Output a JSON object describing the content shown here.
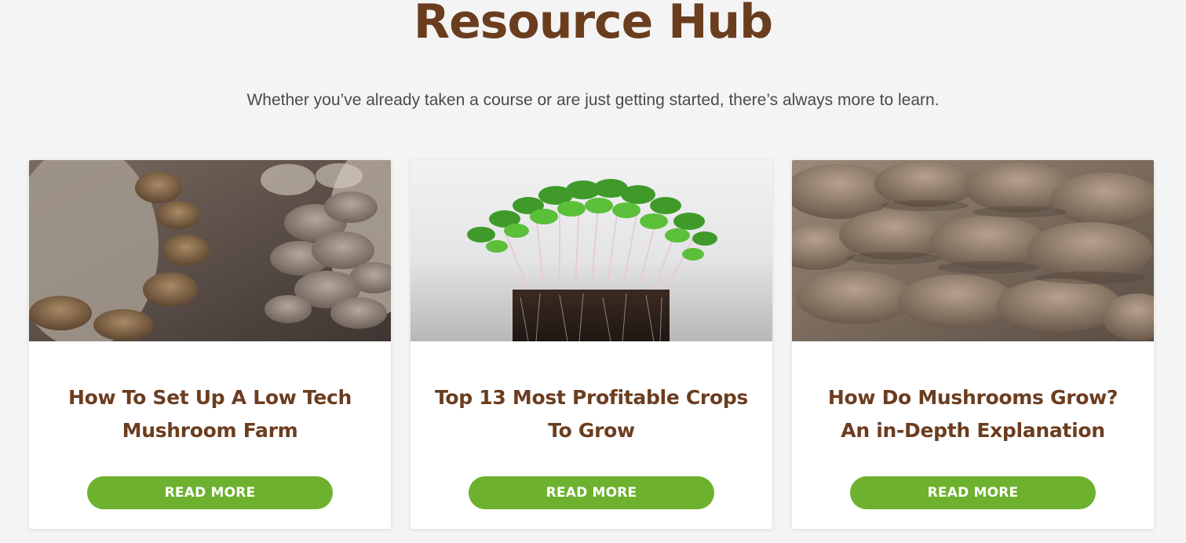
{
  "header": {
    "title": "Resource Hub",
    "subtitle": "Whether you’ve already taken a course or are just getting started, there’s always more to learn."
  },
  "cards": [
    {
      "image": "oyster-mushrooms-photo",
      "title": "How To Set Up A Low Tech Mushroom Farm",
      "button_label": "READ MORE"
    },
    {
      "image": "microgreens-photo",
      "title": "Top 13 Most Profitable Crops To Grow",
      "button_label": "READ MORE"
    },
    {
      "image": "mushroom-closeup-photo",
      "title": "How Do Mushrooms Grow? An in-Depth Explanation",
      "button_label": "READ MORE"
    }
  ],
  "colors": {
    "brand_brown": "#6b3d1f",
    "button_green": "#6db12e",
    "background": "#f4f4f4"
  }
}
